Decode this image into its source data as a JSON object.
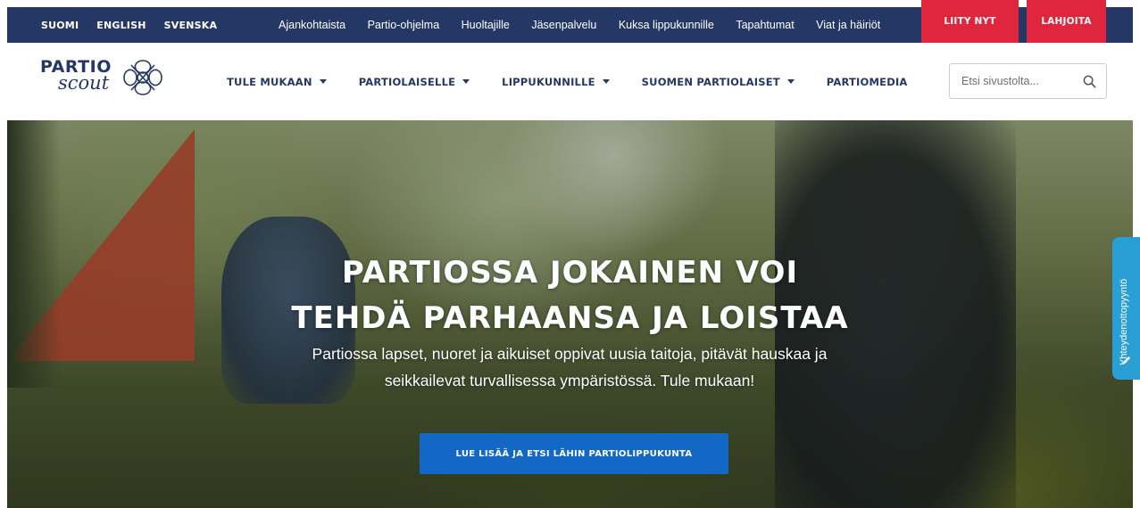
{
  "topbar": {
    "languages": [
      "SUOMI",
      "ENGLISH",
      "SVENSKA"
    ],
    "links": [
      "Ajankohtaista",
      "Partio-ohjelma",
      "Huoltajille",
      "Jäsenpalvelu",
      "Kuksa lippukunnille",
      "Tapahtumat",
      "Viat ja häiriöt"
    ],
    "join_label": "LIITY NYT",
    "donate_label": "LAHJOITA"
  },
  "logo": {
    "line1": "PARTIO",
    "line2": "scout"
  },
  "nav": {
    "items": [
      "TULE MUKAAN",
      "PARTIOLAISELLE",
      "LIPPUKUNNILLE",
      "SUOMEN PARTIOLAISET"
    ],
    "plain_item": "PARTIOMEDIA"
  },
  "search": {
    "placeholder": "Etsi sivustolta...",
    "value": "",
    "icon": "search-icon"
  },
  "hero": {
    "title_line1": "PARTIOSSA JOKAINEN VOI",
    "title_line2": "TEHDÄ PARHAANSA JA LOISTAA",
    "subtitle_line1": "Partiossa lapset, nuoret ja aikuiset oppivat uusia taitoja, pitävät hauskaa ja",
    "subtitle_line2": "seikkailevat turvallisessa ympäristössä. Tule mukaan!",
    "button_label": "LUE LISÄÄ JA ETSI LÄHIN PARTIOLIPPUKUNTA"
  },
  "feedback": {
    "label": "Yhteydenottopyyntö",
    "icon": "pencil-icon"
  },
  "colors": {
    "navy": "#253764",
    "red": "#e0263d",
    "blue": "#1268c4",
    "feedback_blue": "#2a9fd6"
  }
}
